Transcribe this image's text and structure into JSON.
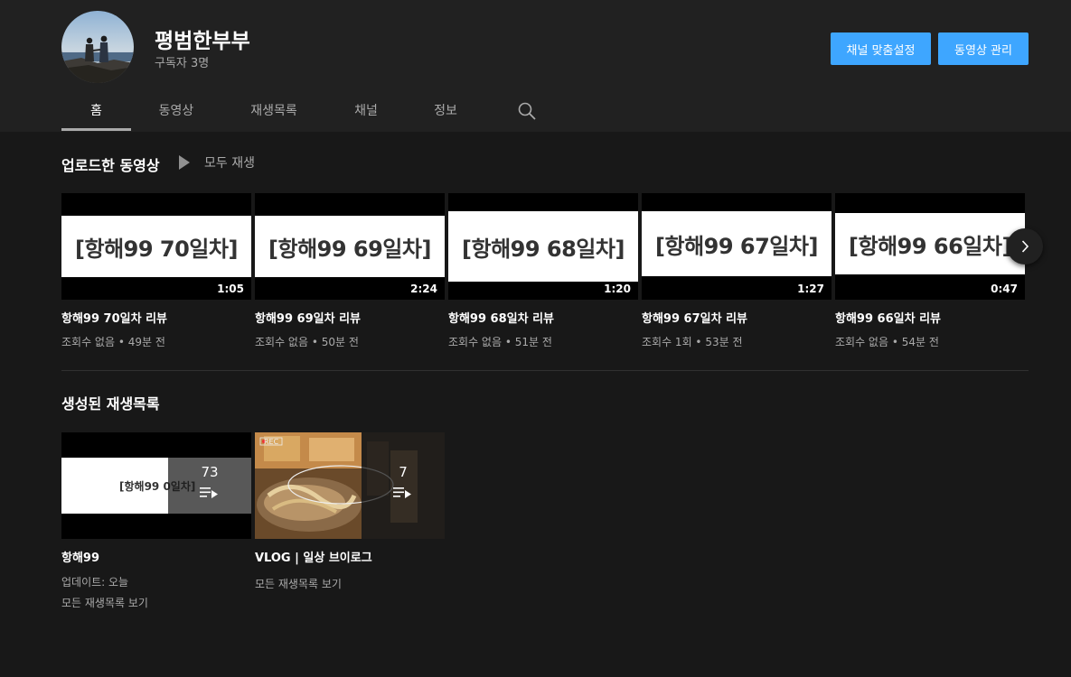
{
  "channel": {
    "name": "평범한부부",
    "subscribers": "구독자 3명",
    "customize_label": "채널 맞춤설정",
    "manage_label": "동영상 관리"
  },
  "tabs": [
    {
      "label": "홈",
      "active": true
    },
    {
      "label": "동영상"
    },
    {
      "label": "재생목록"
    },
    {
      "label": "채널"
    },
    {
      "label": "정보"
    }
  ],
  "uploads": {
    "title": "업로드한 동영상",
    "play_all": "모두 재생",
    "videos": [
      {
        "thumb_text": "[항해99 70일차]",
        "duration": "1:05",
        "title": "항해99 70일차 리뷰",
        "meta": "조회수 없음 • 49분 전"
      },
      {
        "thumb_text": "[항해99 69일차]",
        "duration": "2:24",
        "title": "항해99 69일차 리뷰",
        "meta": "조회수 없음 • 50분 전"
      },
      {
        "thumb_text": "[항해99 68일차]",
        "duration": "1:20",
        "title": "항해99 68일차 리뷰",
        "meta": "조회수 없음 • 51분 전"
      },
      {
        "thumb_text": "[항해99 67일차]",
        "duration": "1:27",
        "title": "항해99 67일차 리뷰",
        "meta": "조회수 1회 • 53분 전"
      },
      {
        "thumb_text": "[항해99 66일차]",
        "duration": "0:47",
        "title": "항해99 66일차 리뷰",
        "meta": "조회수 없음 • 54분 전"
      }
    ]
  },
  "playlists": {
    "title": "생성된 재생목록",
    "items": [
      {
        "thumb_text": "[항해99 0일차]",
        "count": "73",
        "title": "항해99",
        "updated": "업데이트: 오늘",
        "link": "모든 재생목록 보기"
      },
      {
        "thumb_text": "REC",
        "count": "7",
        "title": "VLOG | 일상 브이로그",
        "link": "모든 재생목록 보기"
      }
    ]
  },
  "colors": {
    "background": "#181818",
    "header": "#212121",
    "accent_blue": "#3ea6ff",
    "secondary_text": "#aaaaaa"
  },
  "icons": [
    "search-icon",
    "play-icon",
    "chevron-right-icon",
    "playlist-icon"
  ]
}
